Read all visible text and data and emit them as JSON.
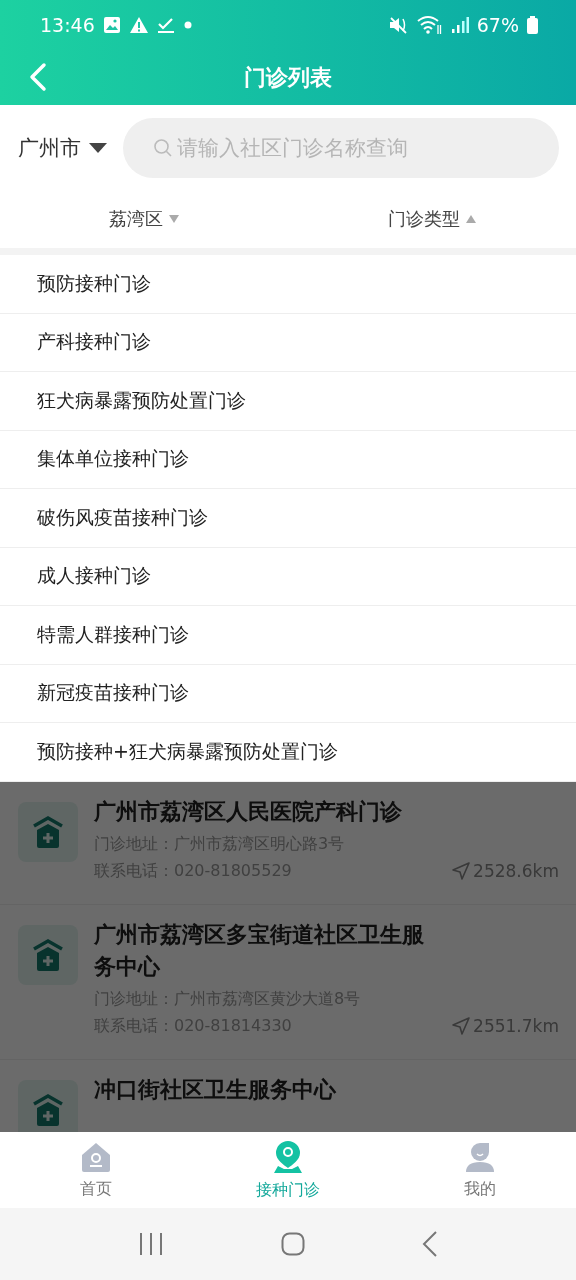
{
  "status_bar": {
    "time": "13:46",
    "battery": "67%"
  },
  "header": {
    "title": "门诊列表"
  },
  "search": {
    "city": "广州市",
    "placeholder": "请输入社区门诊名称查询"
  },
  "filters": [
    {
      "label": "荔湾区",
      "expanded": false
    },
    {
      "label": "门诊类型",
      "expanded": true
    }
  ],
  "type_menu": [
    "预防接种门诊",
    "产科接种门诊",
    "狂犬病暴露预防处置门诊",
    "集体单位接种门诊",
    "破伤风疫苗接种门诊",
    "成人接种门诊",
    "特需人群接种门诊",
    "新冠疫苗接种门诊",
    "预防接种+狂犬病暴露预防处置门诊"
  ],
  "clinics": [
    {
      "name": "广州市荔湾区人民医院产科门诊",
      "address": "门诊地址：广州市荔湾区明心路3号",
      "phone": "联系电话：020-81805529",
      "distance": "2528.6km"
    },
    {
      "name": "广州市荔湾区多宝街道社区卫生服务中心",
      "address": "门诊地址：广州市荔湾区黄沙大道8号",
      "phone": "联系电话：020-81814330",
      "distance": "2551.7km"
    },
    {
      "name": "冲口街社区卫生服务中心"
    }
  ],
  "tab_bar": [
    {
      "label": "首页",
      "kind": "home",
      "selected": false
    },
    {
      "label": "接种门诊",
      "kind": "pin",
      "selected": true
    },
    {
      "label": "我的",
      "kind": "person",
      "selected": false
    }
  ]
}
